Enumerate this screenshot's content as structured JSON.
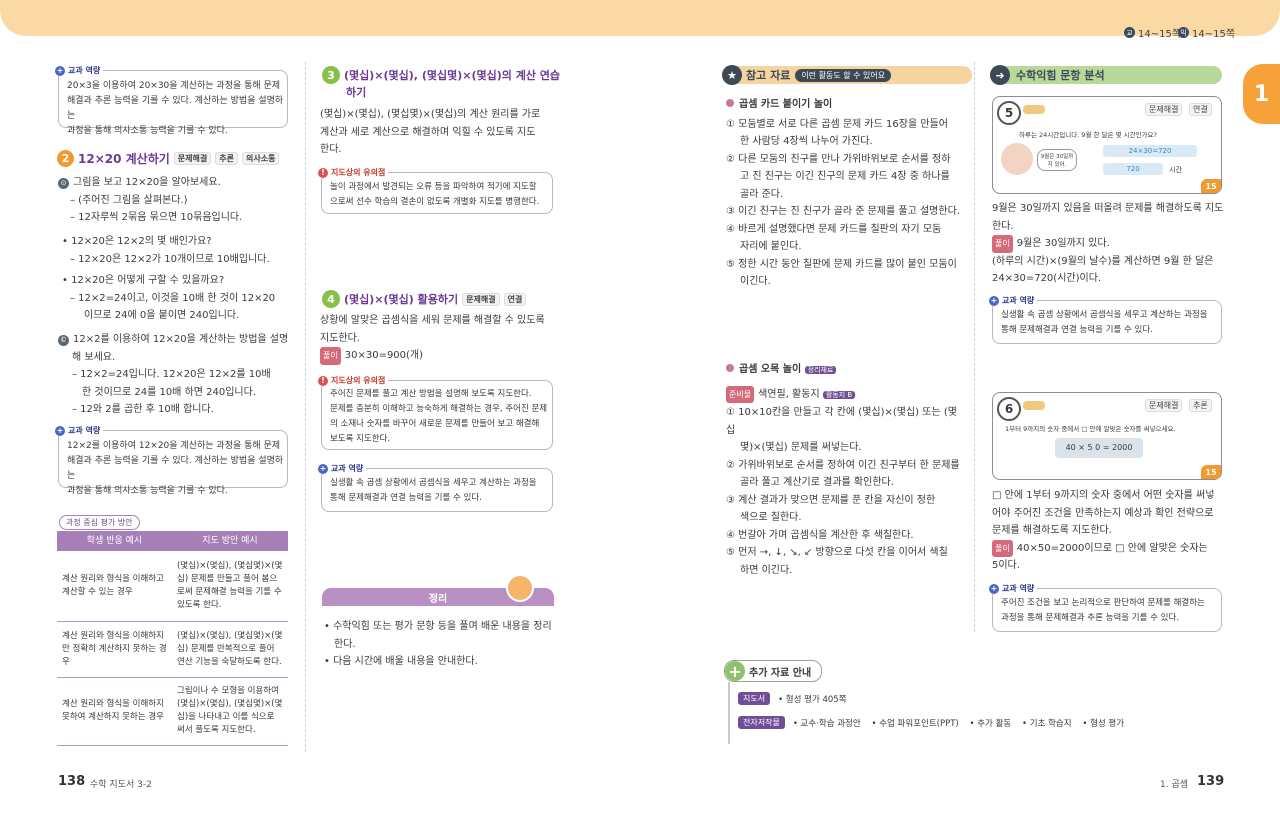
{
  "header": {
    "ref1": "14~15쪽",
    "ref2": "14~15쪽",
    "tab_number": "1"
  },
  "left": {
    "core1": {
      "label": "교과 역량",
      "text": [
        "20×3을 이용하여 20×30을 계산하는 과정을 통해 문제",
        "해결과 추론 능력을 기를 수 있다. 계산하는 방법을 설명하는",
        "과정을 통해 의사소통 능력을 기를 수 있다."
      ]
    },
    "act2": {
      "num": "2",
      "title": "12×20 계산하기",
      "tags": [
        "문제해결",
        "추론",
        "의사소통"
      ]
    },
    "q1": {
      "mark": "⊙",
      "lines": [
        "그림을 보고 12×20을 알아보세요.",
        "– (주어진 그림을 살펴본다.)",
        "– 12자루씩 2묶음 묶으면 10묶음입니다."
      ]
    },
    "q2": {
      "lines": [
        "• 12×20은 12×2의 몇 배인가요?",
        "– 12×20은 12×2가 10개이므로 10배입니다."
      ]
    },
    "q3": {
      "lines": [
        "• 12×20은 어떻게 구할 수 있을까요?",
        "– 12×2=24이고, 이것을 10배 한 것이 12×20",
        "이므로 24에 0을 붙이면 240입니다."
      ]
    },
    "q4": {
      "mark": "©",
      "lines": [
        "12×2를 이용하여 12×20을 계산하는 방법을 설명",
        "해 보세요.",
        "– 12×2=24입니다. 12×20은 12×2를 10배",
        "한 것이므로 24를 10배 하면 240입니다.",
        "– 12와 2를 곱한 후 10배 합니다."
      ]
    },
    "core2": {
      "label": "교과 역량",
      "text": [
        "12×2를 이용하여 12×20을 계산하는 과정을 통해 문제",
        "해결과 추론 능력을 기를 수 있다. 계산하는 방법을 설명하는",
        "과정을 통해 의사소통 능력을 기를 수 있다."
      ]
    },
    "eval_label": "과정 중심 평가 방안",
    "table": {
      "headers": [
        "학생 반응 예시",
        "지도 방안 예시"
      ],
      "rows": [
        {
          "a": "계산 원리와 형식을 이해하고 계산할 수 있는 경우",
          "b": "(몇십)×(몇십), (몇십몇)×(몇십) 문제를 만들고 풀어 봄으로써 문제해결 능력을 기를 수 있도록 한다."
        },
        {
          "a": "계산 원리와 형식을 이해하지만 정확히 계산하지 못하는 경우",
          "b": "(몇십)×(몇십), (몇십몇)×(몇십) 문제를 반복적으로 풀어 연산 기능을 숙달하도록 한다."
        },
        {
          "a": "계산 원리와 형식을 이해하지 못하여 계산하지 못하는 경우",
          "b": "그림이나 수 모형을 이용하여 (몇십)×(몇십), (몇십몇)×(몇십)을 나타내고 이를 식으로 써서 풀도록 지도한다."
        }
      ]
    }
  },
  "mid": {
    "act3": {
      "num": "3",
      "title": "(몇십)×(몇십), (몇십몇)×(몇십)의 계산 연습",
      "title2": "하기"
    },
    "act3_text": [
      "(몇십)×(몇십), (몇십몇)×(몇십)의 계산 원리를 가로",
      "계산과 세로 계산으로 해결하며 익힐 수 있도록 지도",
      "한다."
    ],
    "note1": {
      "label": "지도상의 유의점",
      "text": [
        "놀이 과정에서 발견되는 오류 등을 파악하여 적기에 지도할",
        "으로써 선수 학습의 결손이 없도록 개별화 지도를 병행한다."
      ]
    },
    "act4": {
      "num": "4",
      "title": "(몇십)×(몇십) 활용하기",
      "tags": [
        "문제해결",
        "연결"
      ]
    },
    "act4_text": [
      "상황에 알맞은 곱셈식을 세워 문제를 해결할 수 있도록",
      "지도한다."
    ],
    "act4_solve": {
      "label": "풀이",
      "text": "30×30=900(개)"
    },
    "note2": {
      "label": "지도상의 유의점",
      "text": [
        "주어진 문제를 풀고 계산 방법을 설명해 보도록 지도한다.",
        "문제를 충분히 이해하고 능숙하게 해결하는 경우, 주어진 문제",
        "의 소재나 숫자를 바꾸어 새로운 문제를 만들어 보고 해결해",
        "보도록 지도한다."
      ]
    },
    "core3": {
      "label": "교과 역량",
      "text": [
        "실생활 속 곱셈 상황에서 곱셈식을 세우고 계산하는 과정을",
        "통해 문제해결과 연결 능력을 기를 수 있다."
      ]
    },
    "summary": {
      "title": "정리",
      "items": [
        "• 수학익힘 또는 평가 문항 등을 풀며 배운 내용을 정리",
        "한다.",
        "• 다음 시간에 배울 내용을 안내한다."
      ]
    }
  },
  "right": {
    "ref_title": {
      "badge": "참고 자료",
      "sub": "이런 활동도 할 수 있어요"
    },
    "game1": {
      "title": "곱셈 카드 붙이기 놀이",
      "lines": [
        "① 모둠별로 서로 다른 곱셈 문제 카드 16장을 만들어",
        "한 사람당 4장씩 나누어 가진다.",
        "② 다른 모둠의 친구를 만나 가위바위보로 순서를 정하",
        "고 진 친구는 이긴 친구의 문제 카드 4장 중 하나를",
        "골라 준다.",
        "③ 이긴 친구는 진 친구가 골라 준 문제를 풀고 설명한다.",
        "④ 바르게 설명했다면 문제 카드를 칠판의 자기 모둠",
        "자리에 붙인다.",
        "⑤ 정한 시간 동안 칠판에 문제 카드를 많이 붙인 모둠이",
        "이긴다."
      ]
    },
    "game2": {
      "title": "곱셈 오목 놀이",
      "tag": "정리재료",
      "prep_label": "준비물",
      "prep": "색연필, 활동지",
      "prep_tag": "활동지 B",
      "lines": [
        "① 10×10칸을 만들고 각 칸에 (몇십)×(몇십) 또는 (몇십",
        "몇)×(몇십) 문제를 써넣는다.",
        "② 가위바위보로 순서를 정하여 이긴 친구부터 한 문제를",
        "골라 풀고 계산기로 결과를 확인한다.",
        "③ 계산 결과가 맞으면 문제를 푼 칸을 자신이 정한",
        "색으로 칠한다.",
        "④ 번갈아 가며 곱셈식을 계산한 후 색칠한다.",
        "⑤ 먼저 →, ↓, ↘, ↙ 방향으로 다섯 칸을 이어서 색칠",
        "하면 이긴다."
      ]
    },
    "more": {
      "title": "추가 자료 안내",
      "r1_label": "지도서",
      "r1": "• 형성 평가 405쪽",
      "r2_label": "전자저작물",
      "r2": "• 교수·학습 과정안    • 수업 파워포인트(PPT)    • 추가 활동    • 기초 학습지    • 형성 평가"
    }
  },
  "far": {
    "title": "수학익힘 문항 분석",
    "q5": {
      "num": "5",
      "tags": [
        "문제해결",
        "연결"
      ],
      "prompt": "하루는 24시간입니다. 9월 한 달은 몇 시간인가요?",
      "eq1": "24×30=720",
      "eq2": "720",
      "unit": "시간",
      "page": "15",
      "bubble": "9월은 30일까지 있어."
    },
    "q5_text": [
      "9월은 30일까지 있음을 떠올려 문제를 해결하도록 지도",
      "한다."
    ],
    "q5_solve": {
      "label": "풀이",
      "lines": [
        "9월은 30일까지 있다.",
        "(하루의 시간)×(9월의 날수)를 계산하면 9월 한 달은",
        "24×30=720(시간)이다."
      ]
    },
    "core4": {
      "label": "교과 역량",
      "text": [
        "실생활 속 곱셈 상황에서 곱셈식을 세우고 계산하는 과정을",
        "통해 문제해결과 연결 능력을 기를 수 있다."
      ]
    },
    "q6": {
      "num": "6",
      "tags": [
        "문제해결",
        "추론"
      ],
      "prompt": "1부터 9까지의 숫자 중에서 □ 안에 알맞은 숫자를 써넣으세요.",
      "eq": "40 × 5 0 = 2000",
      "page": "15"
    },
    "q6_text": [
      "□ 안에 1부터 9까지의 숫자 중에서 어떤 숫자를 써넣",
      "어야 주어진 조건을 만족하는지 예상과 확인 전략으로",
      "문제를 해결하도록 지도한다."
    ],
    "q6_solve": {
      "label": "풀이",
      "lines": [
        "40×50=2000이므로 □ 안에 알맞은 숫자는",
        "5이다."
      ]
    },
    "core5": {
      "label": "교과 역량",
      "text": [
        "주어진 조건을 보고 논리적으로 판단하여 문제를 해결하는",
        "과정을 통해 문제해결과 추론 능력을 기를 수 있다."
      ]
    }
  },
  "footer": {
    "left_num": "138",
    "left_text": "수학 지도서 3-2",
    "right_text": "1. 곱셈",
    "right_num": "139"
  }
}
